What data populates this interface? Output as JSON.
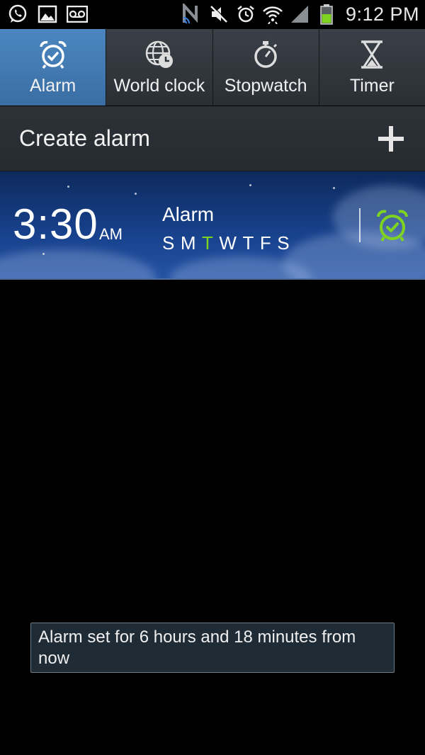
{
  "status_bar": {
    "time": "9:12 PM",
    "icons": [
      "whatsapp-icon",
      "gallery-icon",
      "voicemail-icon",
      "nfc-icon",
      "mute-icon",
      "alarm-icon",
      "wifi-icon",
      "signal-icon",
      "battery-icon"
    ],
    "battery_color": "#7ed321"
  },
  "tabs": [
    {
      "label": "Alarm",
      "icon": "alarm-clock-icon",
      "active": true
    },
    {
      "label": "World clock",
      "icon": "globe-clock-icon",
      "active": false
    },
    {
      "label": "Stopwatch",
      "icon": "stopwatch-icon",
      "active": false
    },
    {
      "label": "Timer",
      "icon": "hourglass-icon",
      "active": false
    }
  ],
  "create": {
    "label": "Create alarm",
    "icon": "plus-icon"
  },
  "alarm": {
    "time": "3:30",
    "ampm": "AM",
    "name": "Alarm",
    "days": [
      {
        "label": "S",
        "on": false
      },
      {
        "label": "M",
        "on": false
      },
      {
        "label": "T",
        "on": true
      },
      {
        "label": "W",
        "on": false
      },
      {
        "label": "T",
        "on": false
      },
      {
        "label": "F",
        "on": false
      },
      {
        "label": "S",
        "on": false
      }
    ],
    "toggle_icon": "alarm-on-icon",
    "active_color": "#7ed321"
  },
  "toast": {
    "message": "Alarm set for 6 hours and 18 minutes from now"
  }
}
